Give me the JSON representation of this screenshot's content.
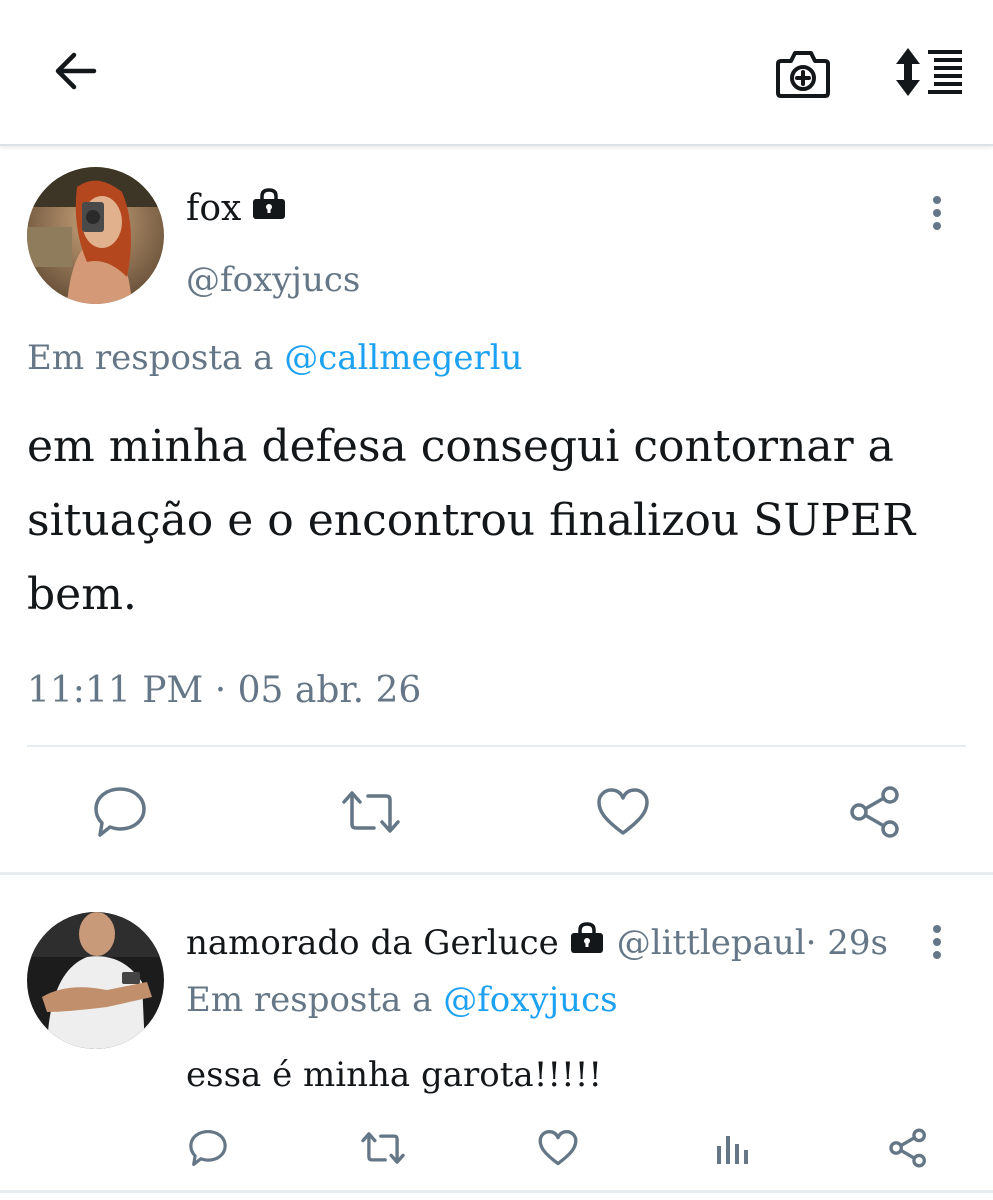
{
  "header": {
    "back_icon": "arrow-left-icon",
    "camera_icon": "camera-plus-icon",
    "sort_icon": "sort-list-icon"
  },
  "tweet": {
    "display_name": "fox",
    "protected_icon": "lock-icon",
    "handle": "@foxyjucs",
    "reply_prefix": "Em resposta a",
    "reply_mention": "@callmegerlu",
    "text": "em minha defesa consegui contornar a situação e o encontrou finalizou SUPER bem.",
    "timestamp": "11:11 PM · 05 abr. 26",
    "actions": [
      "reply-icon",
      "retweet-icon",
      "like-icon",
      "share-icon"
    ]
  },
  "reply": {
    "display_name": "namorado da Gerluce",
    "protected_icon": "lock-icon",
    "handle": "@littlepaul",
    "time": " · 29s",
    "reply_prefix": "Em resposta a",
    "reply_mention": "@foxyjucs",
    "text": "essa é minha garota!!!!!",
    "actions": [
      "reply-icon",
      "retweet-icon",
      "like-icon",
      "stats-icon",
      "share-icon"
    ]
  },
  "colors": {
    "text": "#14171a",
    "secondary": "#657786",
    "link": "#1da1f2",
    "divider": "#e6ecf0"
  }
}
